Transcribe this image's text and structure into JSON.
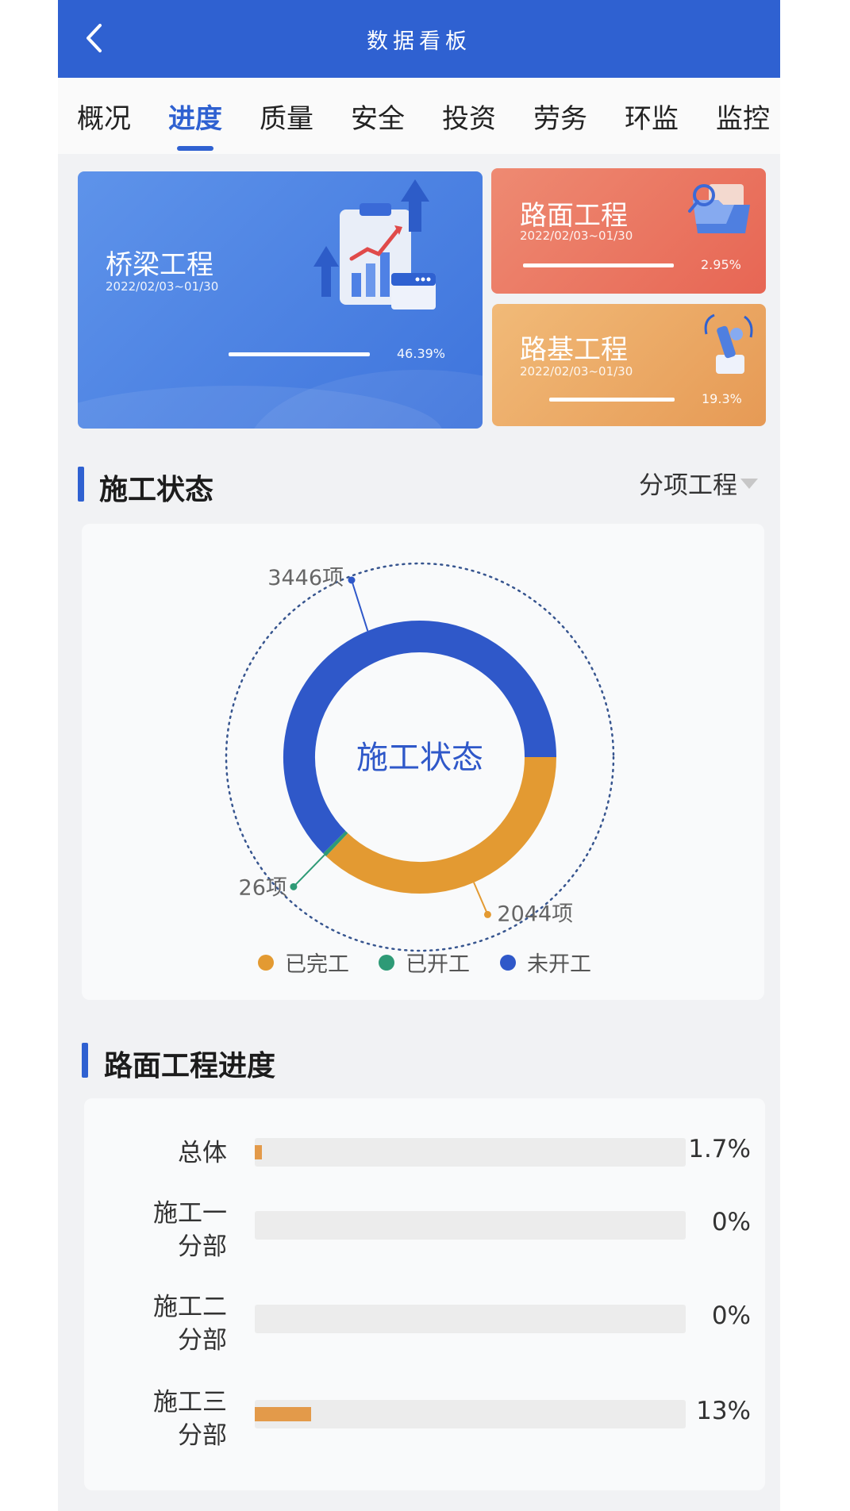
{
  "header": {
    "title": "数据看板",
    "back_icon": "chevron-left-icon"
  },
  "tabs": [
    {
      "label": "概况"
    },
    {
      "label": "进度",
      "active": true
    },
    {
      "label": "质量"
    },
    {
      "label": "安全"
    },
    {
      "label": "投资"
    },
    {
      "label": "劳务"
    },
    {
      "label": "环监"
    },
    {
      "label": "监控"
    }
  ],
  "cards": {
    "bridge": {
      "name": "桥梁工程",
      "date": "2022/02/03~01/30",
      "percent": "46.39%"
    },
    "road": {
      "name": "路面工程",
      "date": "2022/02/03~01/30",
      "percent": "2.95%"
    },
    "base": {
      "name": "路基工程",
      "date": "2022/02/03~01/30",
      "percent": "19.3%"
    }
  },
  "status": {
    "title": "施工状态",
    "dropdown": "分项工程",
    "center_label": "施工状态"
  },
  "chart_data": {
    "type": "pie",
    "title": "施工状态",
    "labels": [
      "已完工",
      "已开工",
      "未开工"
    ],
    "values": [
      2044,
      26,
      3446
    ],
    "value_labels": [
      "2044项",
      "26项",
      "3446项"
    ],
    "colors": [
      "#e39a32",
      "#2e9a76",
      "#2f58c9"
    ],
    "legend_position": "bottom"
  },
  "road_progress": {
    "title": "路面工程进度",
    "rows": [
      {
        "label_lines": [
          "总体"
        ],
        "value": 1.7,
        "percent": "1.7%"
      },
      {
        "label_lines": [
          "施工一",
          "分部"
        ],
        "value": 0,
        "percent": "0%"
      },
      {
        "label_lines": [
          "施工二",
          "分部"
        ],
        "value": 0,
        "percent": "0%"
      },
      {
        "label_lines": [
          "施工三",
          "分部"
        ],
        "value": 13,
        "percent": "13%"
      }
    ],
    "bar_color": "#e39a4a"
  }
}
